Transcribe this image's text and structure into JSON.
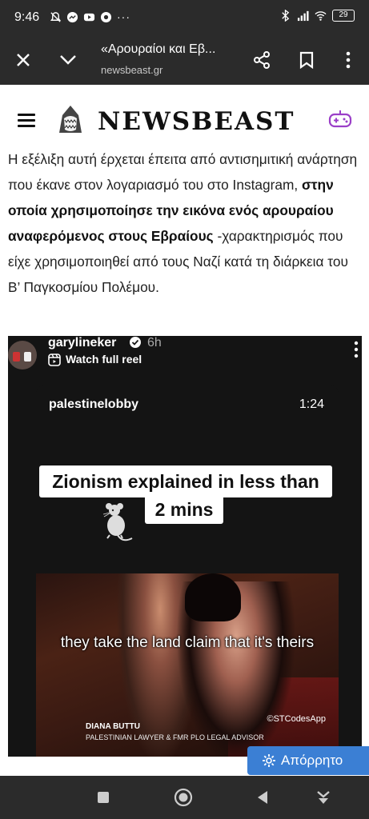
{
  "status": {
    "time": "9:46",
    "battery": "29"
  },
  "toolbar": {
    "title": "«Αρουραίοι και Εβ...",
    "url": "newsbeast.gr"
  },
  "site": {
    "brand": "NEWSBEAST"
  },
  "article": {
    "part1": "Η εξέλιξη αυτή έρχεται έπειτα από αντισημιτική ανάρτηση που έκανε στον λογαριασμό του στο Instagram, ",
    "bold": "στην οποία χρησιμοποίησε την εικόνα ενός αρουραίου αναφερόμενος στους Εβραίους",
    "part2": " -χαρακτηρισμός που είχε χρησιμοποιηθεί από τους Ναζί κατά τη διάρκεια του Β’ Παγκοσμίου Πολέμου."
  },
  "embed": {
    "username": "garylineker",
    "time": "6h",
    "watch_label": "Watch full reel",
    "reel": {
      "username": "palestinelobby",
      "duration": "1:24",
      "caption_line1": "Zionism explained in less than",
      "caption_line2": "2 mins",
      "subtitle": "they take the land claim that it's theirs",
      "credit": "©STCodesApp",
      "lower_name": "DIANA BUTTU",
      "lower_title": "PALESTINIAN LAWYER & FMR PLO LEGAL ADVISOR"
    }
  },
  "consent": {
    "label": "Απόρρητο"
  },
  "colors": {
    "bar_bg": "#2b2b2b",
    "consent_blue": "#3b7fd4",
    "gamepad_purple": "#9b3fc8"
  }
}
